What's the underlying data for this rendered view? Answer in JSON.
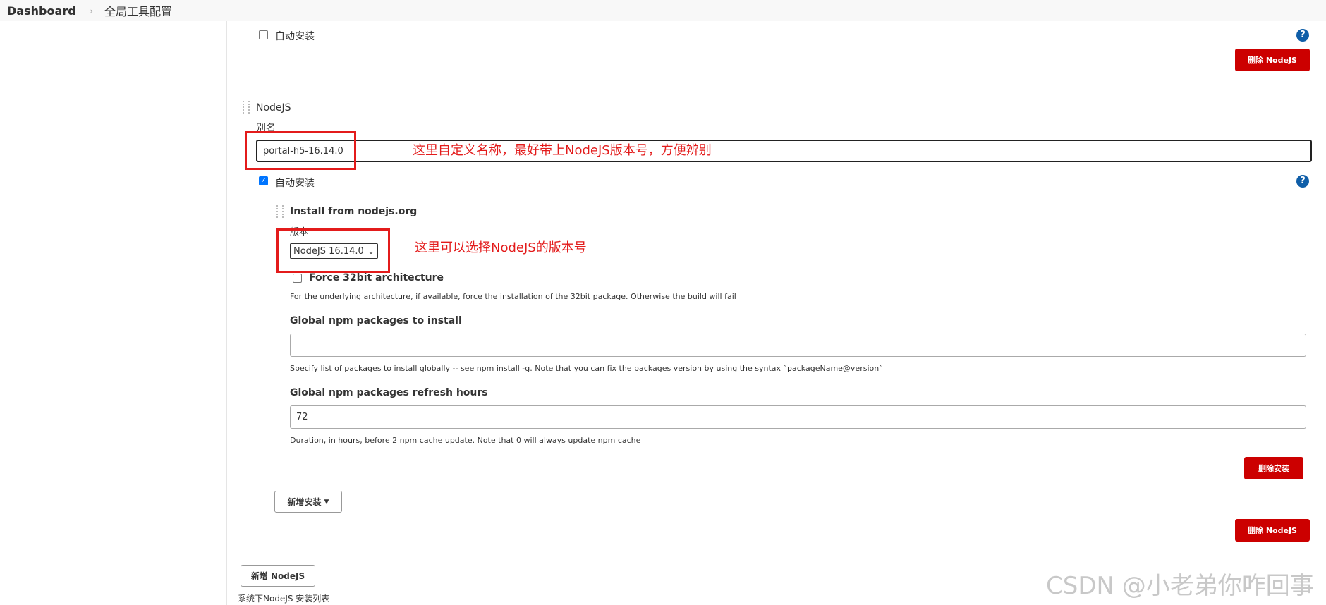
{
  "breadcrumb": {
    "dashboard": "Dashboard",
    "current": "全局工具配置"
  },
  "top_section": {
    "auto_install_label": "自动安装",
    "delete_button": "删除 NodeJS"
  },
  "nodejs": {
    "header": "NodeJS",
    "alias_label": "别名",
    "alias_value": "portal-h5-16.14.0",
    "auto_install_label": "自动安装",
    "installer": {
      "title": "Install from nodejs.org",
      "version_label": "版本",
      "version_value": "NodeJS 16.14.0",
      "force32_label": "Force 32bit architecture",
      "force32_desc": "For the underlying architecture, if available, force the installation of the 32bit package. Otherwise the build will fail",
      "global_pkgs_label": "Global npm packages to install",
      "global_pkgs_value": "",
      "global_pkgs_desc": "Specify list of packages to install globally -- see npm install -g. Note that you can fix the packages version by using the syntax `packageName@version`",
      "refresh_label": "Global npm packages refresh hours",
      "refresh_value": "72",
      "refresh_desc": "Duration, in hours, before 2 npm cache update. Note that 0 will always update npm cache",
      "delete_installer_button": "删除安装"
    },
    "add_installer_button": "新增安装",
    "delete_button": "删除 NodeJS"
  },
  "add_nodejs_button": "新增 NodeJS",
  "footer_text": "系统下NodeJS 安装列表",
  "annotations": {
    "alias_note": "这里自定义名称，最好带上NodeJS版本号，方便辨别",
    "version_note": "这里可以选择NodeJS的版本号"
  },
  "watermark": "CSDN @小老弟你咋回事",
  "colors": {
    "annotation_red": "#e31b1b",
    "button_red": "#cc0000",
    "help_blue": "#0f5ea8",
    "checkbox_blue": "#0075ff"
  }
}
